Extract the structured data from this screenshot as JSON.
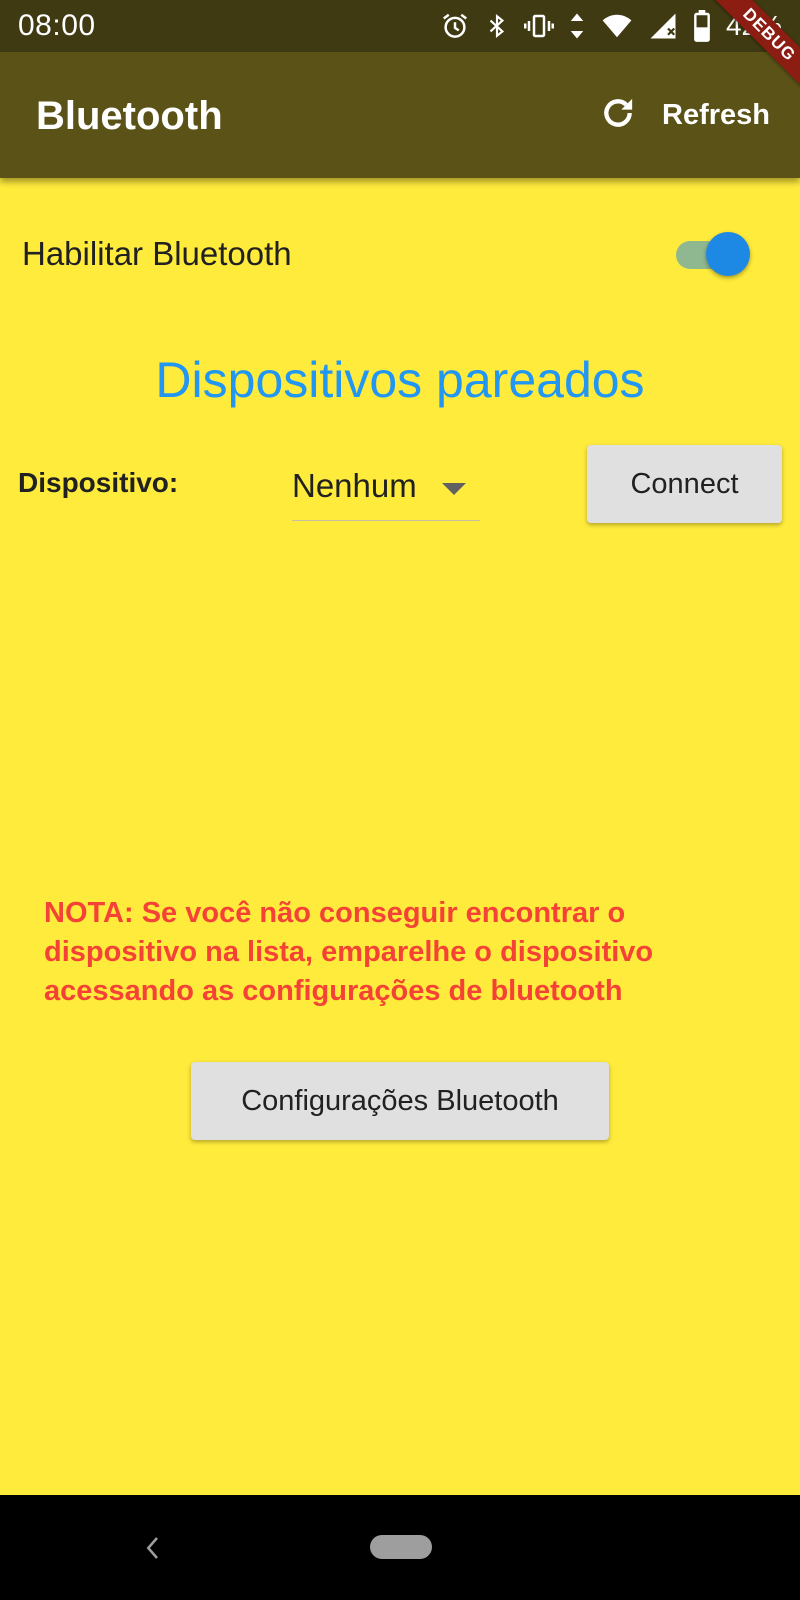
{
  "status_bar": {
    "time": "08:00",
    "battery": "42%",
    "icons": [
      "alarm-icon",
      "bluetooth-icon",
      "vibrate-icon",
      "data-arrows-icon",
      "wifi-icon",
      "signal-icon",
      "battery-icon"
    ]
  },
  "debug_banner": "DEBUG",
  "app_bar": {
    "title": "Bluetooth",
    "refresh_label": "Refresh",
    "refresh_icon": "refresh-icon"
  },
  "bluetooth_toggle": {
    "label": "Habilitar Bluetooth",
    "enabled": true,
    "track_color": "#8fb890",
    "thumb_color": "#1e88e5"
  },
  "section_title": "Dispositivos pareados",
  "device_selector": {
    "label": "Dispositivo:",
    "selected": "Nenhum",
    "connect_label": "Connect"
  },
  "note": "NOTA: Se você não conseguir encontrar o dispositivo na lista, emparelhe o dispositivo acessando as configurações de bluetooth",
  "settings_button": "Configurações Bluetooth",
  "colors": {
    "background": "#FFEB3B",
    "app_bar": "#5a5216",
    "status_bar": "#3f3a12",
    "accent": "#2196f3",
    "note": "#f44336"
  }
}
